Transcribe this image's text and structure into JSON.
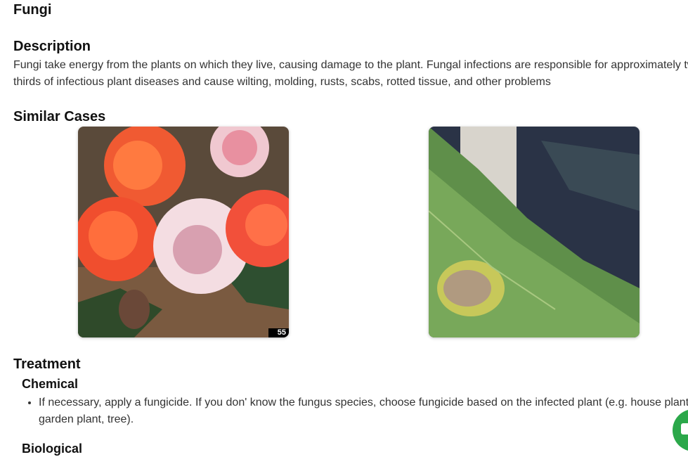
{
  "page": {
    "title": "Fungi"
  },
  "description": {
    "heading": "Description",
    "text": "Fungi take energy from the plants on which they live, causing damage to the plant. Fungal infections are responsible for approximately two-thirds of infectious plant diseases and cause wilting, molding, rusts, scabs, rotted tissue, and other problems"
  },
  "similar_cases": {
    "heading": "Similar Cases",
    "images": [
      {
        "alt": "roses with spotted petals",
        "badge": "55"
      },
      {
        "alt": "leaf with brown lesion"
      }
    ]
  },
  "treatment": {
    "heading": "Treatment",
    "chemical": {
      "heading": "Chemical",
      "items": [
        "If necessary, apply a fungicide. If you don' know the fungus species, choose fungicide based on the infected plant (e.g. house plant, garden plant, tree)."
      ]
    },
    "biological": {
      "heading": "Biological"
    }
  },
  "colors": {
    "chat_button": "#2ba84a"
  }
}
